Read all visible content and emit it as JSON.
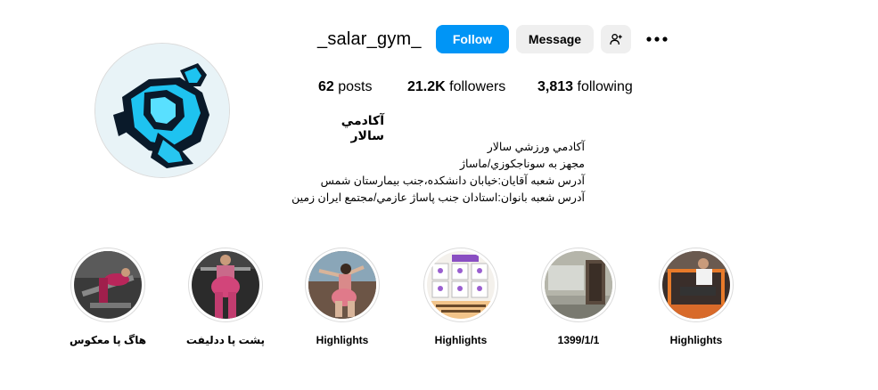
{
  "profile": {
    "username": "_salar_gym_",
    "follow_label": "Follow",
    "message_label": "Message",
    "add_user_icon": "add-user-icon",
    "more_icon": "more-options-icon",
    "posts_count": "62",
    "posts_label": "posts",
    "followers_count": "21.2K",
    "followers_label": "followers",
    "following_count": "3,813",
    "following_label": "following",
    "full_name": "آکادمي سالار",
    "bio_lines": [
      "آکادمي ورزشي سالار",
      "مجهز به سوناجکوزي/ماساژ",
      "آدرس شعبه آقايان:خيابان دانشکده،جنب بيمارستان شمس",
      "آدرس شعبه بانوان:استادان جنب پاساژ عازمي/مجتمع ايران زمين"
    ]
  },
  "highlights": [
    {
      "label": "هاگ پا معکوس"
    },
    {
      "label": "پشت پا ددليفت"
    },
    {
      "label": "Highlights"
    },
    {
      "label": "Highlights"
    },
    {
      "label": "1399/1/1"
    },
    {
      "label": "Highlights"
    }
  ],
  "colors": {
    "follow_bg": "#0095f6",
    "secondary_bg": "#efefef",
    "border": "#dbdbdb"
  }
}
